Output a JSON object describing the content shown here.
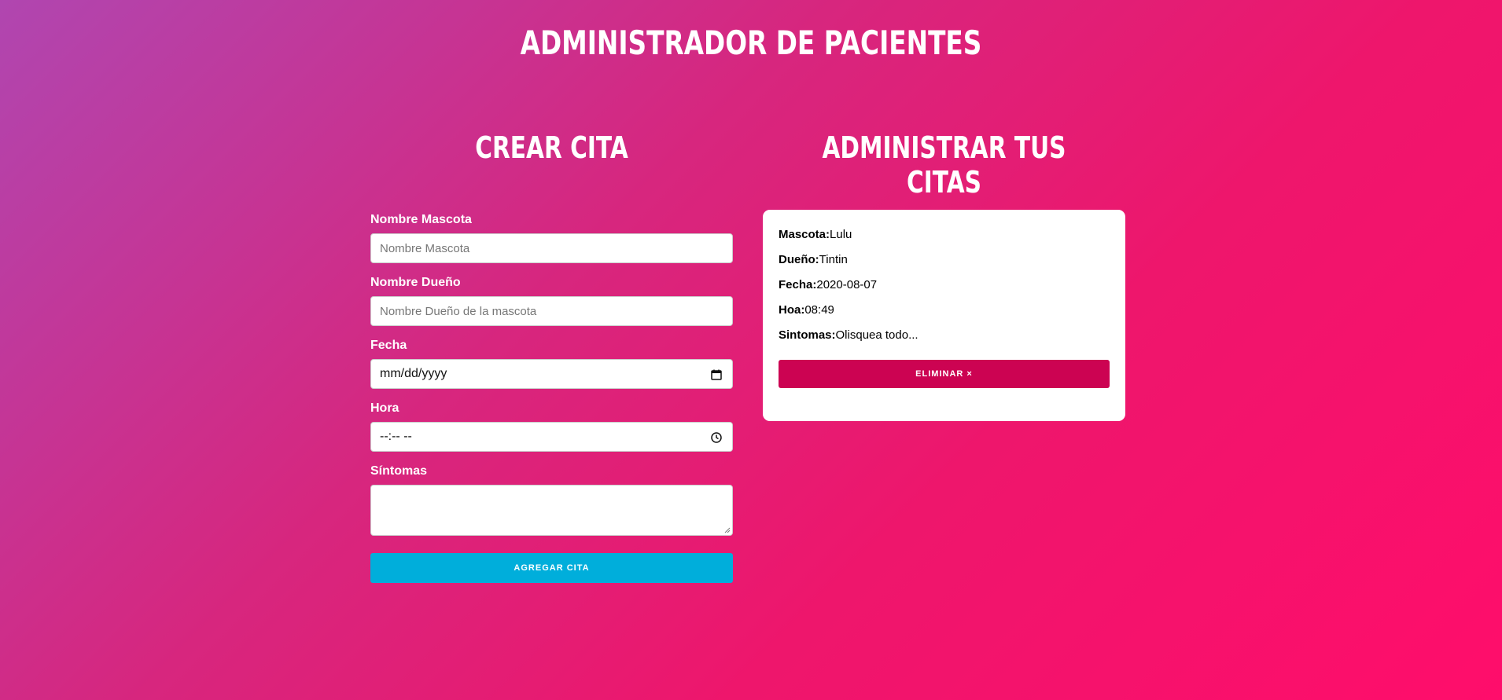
{
  "app": {
    "title": "ADMINISTRADOR DE PACIENTES"
  },
  "create": {
    "title": "CREAR CITA",
    "pet_label": "Nombre Mascota",
    "pet_placeholder": "Nombre Mascota",
    "owner_label": "Nombre Dueño",
    "owner_placeholder": "Nombre Dueño de la mascota",
    "date_label": "Fecha",
    "date_value": "mm/dd/yyyy",
    "time_label": "Hora",
    "time_value": "--:-- --",
    "symptoms_label": "Síntomas",
    "symptoms_value": "",
    "submit_label": "AGREGAR CITA"
  },
  "manage": {
    "title": "ADMINISTRAR TUS CITAS",
    "appointment": {
      "pet_key": "Mascota:",
      "pet": "Lulu",
      "owner_key": "Dueño:",
      "owner": "Tintin",
      "date_key": "Fecha:",
      "date": "2020-08-07",
      "time_key": "Hoa:",
      "time": "08:49",
      "symptoms_key": "Sintomas:",
      "symptoms": "Olisquea todo...",
      "delete_label": "ELIMINAR ×"
    }
  },
  "icons": {
    "calendar": "calendar-icon",
    "clock": "clock-icon"
  },
  "colors": {
    "add_button": "#00aedb",
    "delete_button": "#cc0352"
  }
}
